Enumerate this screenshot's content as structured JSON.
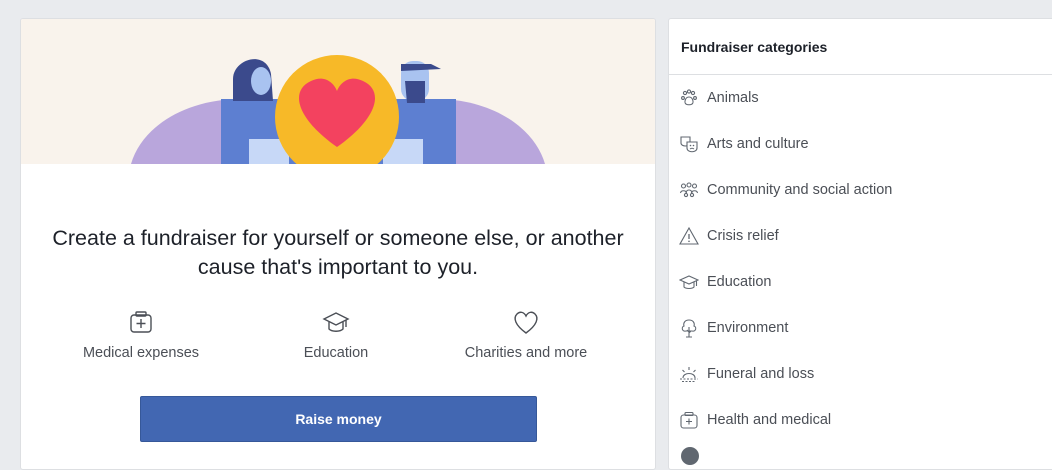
{
  "main": {
    "headline": "Create a fundraiser for yourself or someone else, or another cause that's important to you.",
    "features": [
      {
        "label": "Medical expenses",
        "icon": "medical-kit-icon"
      },
      {
        "label": "Education",
        "icon": "graduation-cap-icon"
      },
      {
        "label": "Charities and more",
        "icon": "heart-icon"
      }
    ],
    "raise_button": "Raise money"
  },
  "sidebar": {
    "title": "Fundraiser categories",
    "items": [
      {
        "label": "Animals",
        "icon": "paw-icon"
      },
      {
        "label": "Arts and culture",
        "icon": "theater-masks-icon"
      },
      {
        "label": "Community and social action",
        "icon": "people-group-icon"
      },
      {
        "label": "Crisis relief",
        "icon": "warning-triangle-icon"
      },
      {
        "label": "Education",
        "icon": "graduation-cap-icon"
      },
      {
        "label": "Environment",
        "icon": "tree-icon"
      },
      {
        "label": "Funeral and loss",
        "icon": "sunset-icon"
      },
      {
        "label": "Health and medical",
        "icon": "medical-kit-icon"
      }
    ]
  },
  "colors": {
    "primary_button": "#4267b2",
    "heart": "#f3425f",
    "circle": "#f7b928",
    "hero_background": "#f9f3ec",
    "arms": "#b9a6dc",
    "shirts": "#5d7fd1"
  }
}
